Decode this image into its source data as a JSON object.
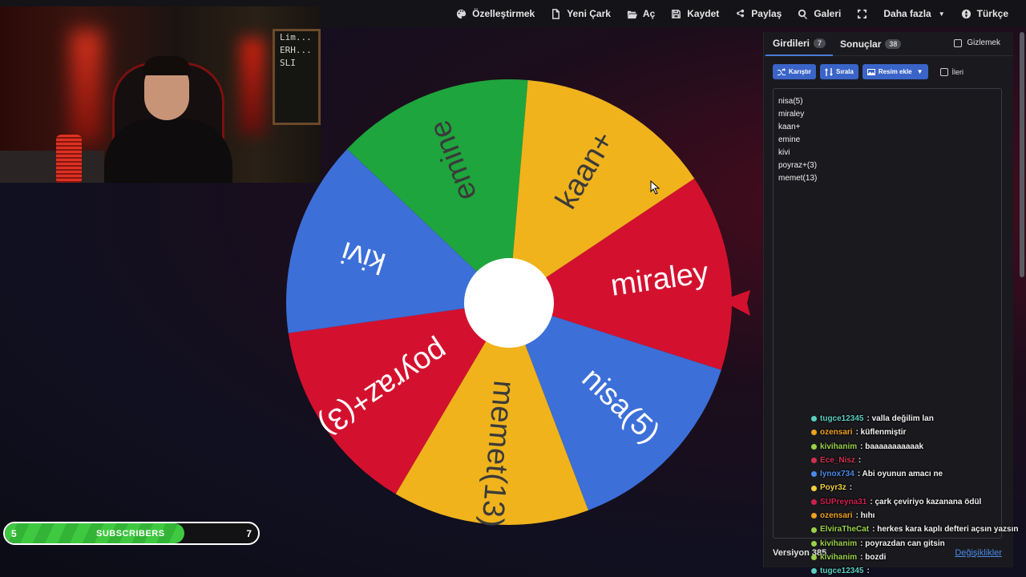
{
  "nav": {
    "items": [
      {
        "label": "Özelleştirmek",
        "icon": "palette-icon"
      },
      {
        "label": "Yeni Çark",
        "icon": "file-icon"
      },
      {
        "label": "Aç",
        "icon": "folder-open-icon"
      },
      {
        "label": "Kaydet",
        "icon": "save-icon"
      },
      {
        "label": "Paylaş",
        "icon": "share-icon"
      },
      {
        "label": "Galeri",
        "icon": "search-icon"
      },
      {
        "label": "",
        "icon": "fullscreen-icon"
      },
      {
        "label": "Daha fazla",
        "icon": "chevron-down-icon"
      },
      {
        "label": "Türkçe",
        "icon": "globe-icon"
      }
    ]
  },
  "webcam": {
    "board_lines": [
      "Lim...",
      "ERH...",
      "SLI"
    ]
  },
  "wheel": {
    "segments": [
      {
        "label": "miraley",
        "color": "#d3112e"
      },
      {
        "label": "nisa(5)",
        "color": "#3c6fd8"
      },
      {
        "label": "memet(13)",
        "color": "#f0b31c"
      },
      {
        "label": "poyraz+(3)",
        "color": "#d3112e"
      },
      {
        "label": "kivi",
        "color": "#3c6fd8"
      },
      {
        "label": "emine",
        "color": "#1ea53d"
      },
      {
        "label": "kaan+",
        "color": "#f0b31c"
      }
    ],
    "pointer_color": "#d3112e"
  },
  "panel": {
    "tabs": [
      {
        "label": "Girdileri",
        "count": "7"
      },
      {
        "label": "Sonuçlar",
        "count": "38"
      }
    ],
    "hide_label": "Gizlemek",
    "toolbar": {
      "shuffle": "Karıştır",
      "sort": "Sırala",
      "add_image": "Resim ekle",
      "advanced": "İleri"
    },
    "entries": [
      "nisa(5)",
      "miraley",
      "kaan+",
      "emine",
      "kivi",
      "poyraz+(3)",
      "memet(13)"
    ],
    "version": "Versiyon 385",
    "changes": "Değişiklikler"
  },
  "chat": [
    {
      "user": "tugce12345",
      "text": " : valla değilim lan",
      "color": "#5ad0c0"
    },
    {
      "user": "ozensari",
      "text": " : küflenmiştir",
      "color": "#f0a020"
    },
    {
      "user": "kivihanim",
      "text": " : baaaaaaaaaaak",
      "color": "#9bd14a"
    },
    {
      "user": "Ece_Nisz",
      "text": " :",
      "color": "#d03050"
    },
    {
      "user": "lynox734",
      "text": " : Abi oyunun amacı ne",
      "color": "#4a8ae8"
    },
    {
      "user": "Poyr3z",
      "text": " :",
      "color": "#f0d040"
    },
    {
      "user": "SUPreyna31",
      "text": " : çark çeviriyo kazanana ödül",
      "color": "#d02050"
    },
    {
      "user": "ozensari",
      "text": " : hıhı",
      "color": "#f0a020"
    },
    {
      "user": "ElviraTheCat",
      "text": " : herkes kara kaplı defteri açsın yazsın",
      "color": "#9bd14a"
    },
    {
      "user": "kivihanim",
      "text": " : poyrazdan can gitsin",
      "color": "#9bd14a"
    },
    {
      "user": "kivihanim",
      "text": " : bozdi",
      "color": "#9bd14a"
    },
    {
      "user": "tugce12345",
      "text": " :",
      "color": "#5ad0c0"
    }
  ],
  "subs": {
    "current": "5",
    "label": "SUBSCRIBERS",
    "goal": "7",
    "progress": 0.71
  }
}
